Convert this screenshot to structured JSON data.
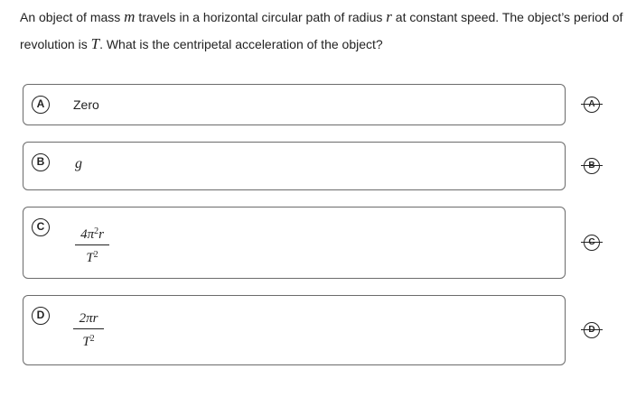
{
  "question": {
    "p1": "An object of mass ",
    "var_m": "m",
    "p2": " travels in a horizontal circular path of radius ",
    "var_r": "r",
    "p3": " at constant speed. The object’s period of revolution is ",
    "var_T": "T",
    "p4": ". What is the centripetal acceleration of the object?"
  },
  "options": [
    {
      "letter": "A",
      "text": "Zero"
    },
    {
      "letter": "B",
      "text": "g"
    },
    {
      "letter": "C",
      "numerator_prefix": "4π",
      "numerator_exp": "2",
      "numerator_suffix": "r",
      "denominator": "T",
      "denominator_exp": "2"
    },
    {
      "letter": "D",
      "numerator": "2πr",
      "denominator": "T",
      "denominator_exp": "2"
    }
  ]
}
